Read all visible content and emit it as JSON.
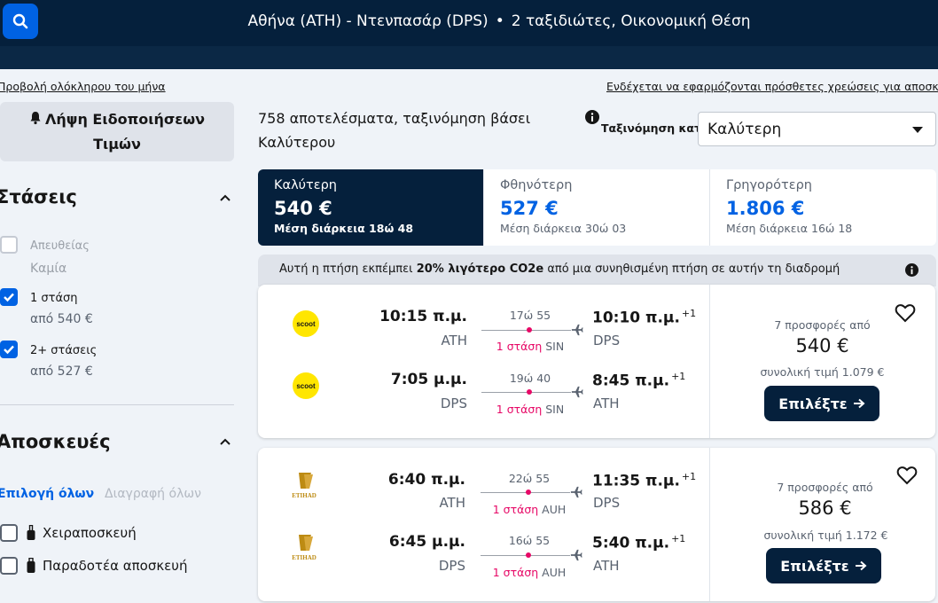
{
  "header": {
    "route": "Αθήνα (ATH) - Ντενπασάρ (DPS)",
    "separator": "•",
    "travelers": "2 ταξιδιώτες, Οικονομική Θέση"
  },
  "filters": {
    "whole_month_link": "Προβολή ολόκληρου του μήνα",
    "price_alert_line1": "Λήψη Ειδοποιήσεων",
    "price_alert_line2": "Τιμών",
    "stops_title": "Στάσεις",
    "stops": [
      {
        "label": "Απευθείας",
        "sub": "Καμία",
        "checked": false,
        "disabled": true
      },
      {
        "label": "1 στάση",
        "sub": "από 540 €",
        "checked": true,
        "disabled": false
      },
      {
        "label": "2+ στάσεις",
        "sub": "από 527 €",
        "checked": true,
        "disabled": false
      }
    ],
    "baggage_title": "Αποσκευές",
    "select_all": "Επιλογή όλων",
    "clear_all": "Διαγραφή όλων",
    "bags": [
      {
        "label": "Χειραποσκευή",
        "checked": false
      },
      {
        "label": "Παραδοτέα αποσκευή",
        "checked": false
      }
    ]
  },
  "results": {
    "extra_fees_link": "Ενδέχεται να εφαρμόζονται πρόσθετες χρεώσεις για αποσκευές",
    "summary_line1": "758 αποτελέσματα, ταξινόμηση βάσει",
    "summary_line2": "Καλύτερου",
    "sort_label": "Ταξινόμηση κατά",
    "sort_value": "Καλύτερη",
    "tabs": [
      {
        "label": "Καλύτερη",
        "price": "540 €",
        "duration_prefix": "Μέση διάρκεια",
        "duration": "18ώ 48",
        "active": true
      },
      {
        "label": "Φθηνότερη",
        "price": "527 €",
        "duration_prefix": "Μέση διάρκεια",
        "duration": "30ώ 03",
        "active": false
      },
      {
        "label": "Γρηγορότερη",
        "price": "1.806 €",
        "duration_prefix": "Μέση διάρκεια",
        "duration": "16ώ 18",
        "active": false
      }
    ],
    "eco_prefix": "Αυτή η πτήση εκπέμπει",
    "eco_highlight": "20% λιγότερο CO2e",
    "eco_suffix": "από μια συνηθισμένη πτήση σε αυτήν τη διαδρομή",
    "cards": [
      {
        "airline": "scoot",
        "legs": [
          {
            "dep_time": "10:15 π.μ.",
            "dep_code": "ATH",
            "duration": "17ώ 55",
            "stops": "1 στάση",
            "via": "SIN",
            "arr_time": "10:10 π.μ.",
            "arr_offset": "+1",
            "arr_code": "DPS"
          },
          {
            "dep_time": "7:05 μ.μ.",
            "dep_code": "DPS",
            "duration": "19ώ 40",
            "stops": "1 στάση",
            "via": "SIN",
            "arr_time": "8:45 π.μ.",
            "arr_offset": "+1",
            "arr_code": "ATH"
          }
        ],
        "offers": "7 προσφορές από",
        "price": "540 €",
        "total": "συνολική τιμή 1.079 €",
        "button": "Επιλέξτε"
      },
      {
        "airline": "ETIHAD",
        "legs": [
          {
            "dep_time": "6:40 π.μ.",
            "dep_code": "ATH",
            "duration": "22ώ 55",
            "stops": "1 στάση",
            "via": "AUH",
            "arr_time": "11:35 π.μ.",
            "arr_offset": "+1",
            "arr_code": "DPS"
          },
          {
            "dep_time": "6:45 μ.μ.",
            "dep_code": "DPS",
            "duration": "16ώ 55",
            "stops": "1 στάση",
            "via": "AUH",
            "arr_time": "5:40 π.μ.",
            "arr_offset": "+1",
            "arr_code": "ATH"
          }
        ],
        "offers": "7 προσφορές από",
        "price": "586 €",
        "total": "συνολική τιμή 1.172 €",
        "button": "Επιλέξτε"
      }
    ]
  },
  "colors": {
    "header_bg": "#05203c",
    "accent_blue": "#0062e3",
    "stop_pink": "#e70866",
    "scoot_yellow": "#ffe600",
    "etihad_gold": "#bd8b13"
  }
}
